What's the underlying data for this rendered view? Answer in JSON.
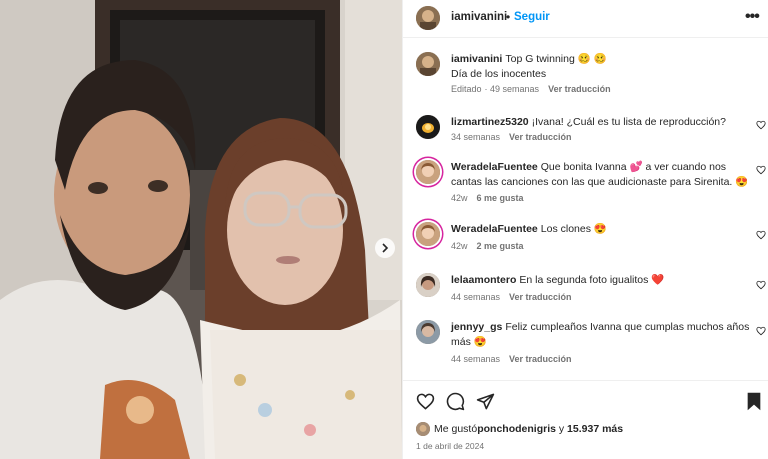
{
  "header": {
    "username": "iamivanini",
    "dot": "•",
    "follow": "Seguir",
    "more": "•••"
  },
  "caption": {
    "username": "iamivanini",
    "line1": "Top G twinning 🥴 🥴",
    "line2": "Día de los inocentes",
    "edited": "Editado",
    "time": "· 49 semanas",
    "translate": "Ver traducción"
  },
  "comments": [
    {
      "username": "lizmartinez5320",
      "text": "¡Ivana! ¿Cuál es tu lista de reproducción?",
      "time": "34 semanas",
      "likes": "",
      "translate": "Ver traducción"
    },
    {
      "username": "WeradelaFuentee",
      "text": "Que bonita Ivanna 💕 a ver cuando nos cantas las canciones con las que audicionaste para Sirenita. 😍",
      "time": "42w",
      "likes": "6 me gusta",
      "translate": ""
    },
    {
      "username": "WeradelaFuentee",
      "text": "Los clones 😍",
      "time": "42w",
      "likes": "2 me gusta",
      "translate": ""
    },
    {
      "username": "lelaamontero",
      "text": "En la segunda foto igualitos ❤️",
      "time": "44 semanas",
      "likes": "",
      "translate": "Ver traducción"
    },
    {
      "username": "jennyy_gs",
      "text": "Feliz cumpleaños Ivanna que cumplas muchos años más 😍",
      "time": "44 semanas",
      "likes": "",
      "translate": "Ver traducción"
    }
  ],
  "likes": {
    "prefix": "Me gustó",
    "user": "ponchodenigris",
    "middle": " y ",
    "count": "15.937 más"
  },
  "date": "1 de abril de 2024",
  "colors": {
    "link": "#0095f6",
    "text": "#262626",
    "muted": "#737373",
    "story_ring": "#d6249f"
  }
}
